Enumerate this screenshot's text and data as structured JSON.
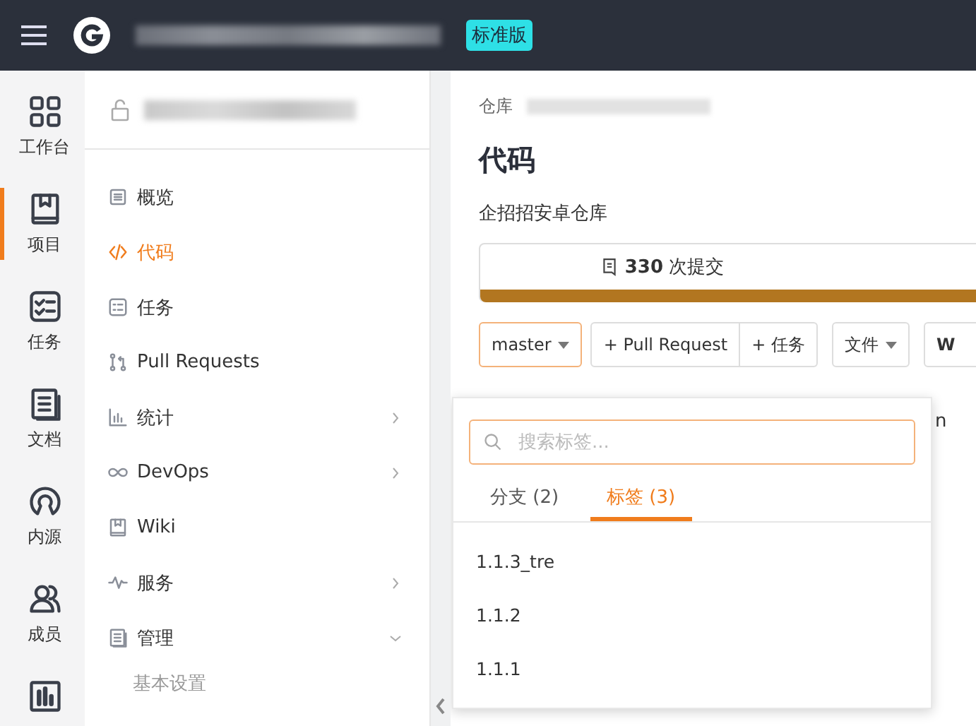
{
  "top_bar": {
    "edition_badge": "标准版"
  },
  "nav_rail": [
    {
      "label": "工作台",
      "selected": false
    },
    {
      "label": "项目",
      "selected": true
    },
    {
      "label": "任务",
      "selected": false
    },
    {
      "label": "文档",
      "selected": false
    },
    {
      "label": "内源",
      "selected": false
    },
    {
      "label": "成员",
      "selected": false
    },
    {
      "selected": false
    }
  ],
  "sidebar": {
    "items": [
      {
        "label": "概览",
        "kind": "link",
        "selected": false
      },
      {
        "label": "代码",
        "kind": "link",
        "selected": true
      },
      {
        "label": "任务",
        "kind": "link",
        "selected": false
      },
      {
        "label": "Pull Requests",
        "kind": "link",
        "selected": false
      },
      {
        "label": "统计",
        "kind": "group",
        "selected": false,
        "expanded": false
      },
      {
        "label": "DevOps",
        "kind": "group",
        "selected": false,
        "expanded": false
      },
      {
        "label": "Wiki",
        "kind": "link",
        "selected": false
      },
      {
        "label": "服务",
        "kind": "group",
        "selected": false,
        "expanded": false
      },
      {
        "label": "管理",
        "kind": "group",
        "selected": false,
        "expanded": true,
        "children": [
          {
            "label": "基本设置"
          }
        ]
      }
    ]
  },
  "main": {
    "breadcrumb": "仓库",
    "title": "代码",
    "description": "企招招安卓仓库",
    "commits": {
      "count": "330",
      "label": "次提交"
    },
    "toolbar": [
      {
        "label": "master",
        "kind": "dropdown",
        "active": true
      },
      {
        "label": "+ Pull Request",
        "kind": "button",
        "active": false
      },
      {
        "label": "+ 任务",
        "kind": "button",
        "active": false
      },
      {
        "label": "文件",
        "kind": "dropdown",
        "active": false
      },
      {
        "label": "W",
        "kind": "cut",
        "active": false
      }
    ],
    "behind_text": "n",
    "branch_popup": {
      "search": {
        "placeholder": "搜索标签..."
      },
      "tabs": [
        {
          "label": "分支 (2)",
          "selected": false
        },
        {
          "label": "标签 (3)",
          "selected": true
        }
      ],
      "items": [
        "1.1.3_tre",
        "1.1.2",
        "1.1.1"
      ]
    }
  }
}
